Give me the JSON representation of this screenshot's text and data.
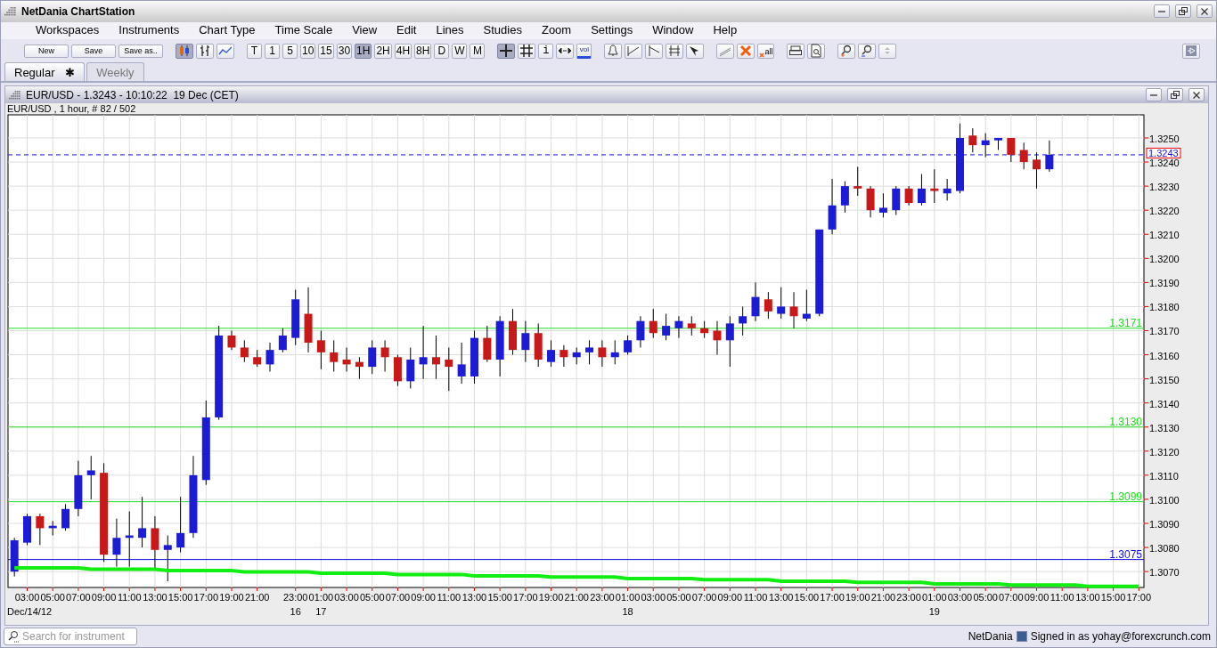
{
  "window": {
    "title": "NetDania ChartStation"
  },
  "menu": [
    "Workspaces",
    "Instruments",
    "Chart Type",
    "Time Scale",
    "View",
    "Edit",
    "Lines",
    "Studies",
    "Zoom",
    "Settings",
    "Window",
    "Help"
  ],
  "toolbar": {
    "buttons": [
      "New",
      "Save",
      "Save as.."
    ],
    "chart_types": [
      {
        "kind": "candlestick",
        "selected": true
      },
      {
        "kind": "bar",
        "selected": false
      },
      {
        "kind": "line",
        "selected": false
      }
    ],
    "time_scales": [
      {
        "label": "T",
        "selected": false
      },
      {
        "label": "1",
        "selected": false
      },
      {
        "label": "5",
        "selected": false
      },
      {
        "label": "10",
        "selected": false
      },
      {
        "label": "15",
        "selected": false
      },
      {
        "label": "30",
        "selected": false
      },
      {
        "label": "1H",
        "selected": true
      },
      {
        "label": "2H",
        "selected": false
      },
      {
        "label": "4H",
        "selected": false
      },
      {
        "label": "8H",
        "selected": false
      },
      {
        "label": "D",
        "selected": false
      },
      {
        "label": "W",
        "selected": false
      },
      {
        "label": "M",
        "selected": false
      }
    ],
    "crosshair_on": true,
    "info_label": "i",
    "volume_label": "vol",
    "delete_all_label": "all"
  },
  "workspace_tabs": [
    {
      "label": "Regular",
      "modified_mark": "✱",
      "selected": true
    },
    {
      "label": "Weekly",
      "selected": false
    }
  ],
  "chart_window": {
    "title": "EUR/USD - 1.3243 - 10:10:22  19 Dec (CET)",
    "subtitle": "EUR/USD , 1 hour, # 82 / 502",
    "chart_data": {
      "type": "candlestick",
      "grid": true,
      "ylim": [
        1.30634,
        1.32596
      ],
      "yticks": [
        {
          "value": 1.307,
          "label": "1.3070"
        },
        {
          "value": 1.308,
          "label": "1.3080"
        },
        {
          "value": 1.309,
          "label": "1.3090"
        },
        {
          "value": 1.31,
          "label": "1.3100"
        },
        {
          "value": 1.311,
          "label": "1.3110"
        },
        {
          "value": 1.312,
          "label": "1.3120"
        },
        {
          "value": 1.313,
          "label": "1.3130"
        },
        {
          "value": 1.314,
          "label": "1.3140"
        },
        {
          "value": 1.315,
          "label": "1.3150"
        },
        {
          "value": 1.316,
          "label": "1.3160"
        },
        {
          "value": 1.317,
          "label": "1.3170"
        },
        {
          "value": 1.318,
          "label": "1.3180"
        },
        {
          "value": 1.319,
          "label": "1.3190"
        },
        {
          "value": 1.32,
          "label": "1.3200"
        },
        {
          "value": 1.321,
          "label": "1.3210"
        },
        {
          "value": 1.322,
          "label": "1.3220"
        },
        {
          "value": 1.323,
          "label": "1.3230"
        },
        {
          "value": 1.324,
          "label": "1.3240"
        },
        {
          "value": 1.325,
          "label": "1.3250"
        }
      ],
      "categories": [
        null,
        "03:00",
        null,
        "05:00",
        null,
        "07:00",
        null,
        "09:00",
        null,
        "11:00",
        null,
        "13:00",
        null,
        "15:00",
        null,
        "17:00",
        null,
        "19:00",
        null,
        "21:00",
        null,
        null,
        "23:00",
        null,
        "01:00",
        null,
        "03:00",
        null,
        "05:00",
        null,
        "07:00",
        null,
        "09:00",
        null,
        "11:00",
        null,
        "13:00",
        null,
        "15:00",
        null,
        "17:00",
        null,
        "19:00",
        null,
        "21:00",
        null,
        "23:00",
        null,
        "01:00",
        null,
        "03:00",
        null,
        "05:00",
        null,
        "07:00",
        null,
        "09:00",
        null,
        "11:00",
        null,
        "13:00",
        null,
        "15:00",
        null,
        "17:00",
        null,
        "19:00",
        null,
        "21:00",
        null,
        "23:00",
        null,
        "01:00",
        null,
        "03:00",
        null,
        "05:00",
        null,
        "07:00",
        null,
        "09:00",
        null,
        "11:00",
        null,
        "13:00",
        null,
        "15:00",
        null,
        "17:00"
      ],
      "ohlc": [
        [
          1.307,
          1.3084,
          1.3068,
          1.3083
        ],
        [
          1.3082,
          1.3094,
          1.3081,
          1.3093
        ],
        [
          1.3093,
          1.3094,
          1.3081,
          1.3088
        ],
        [
          1.3088,
          1.3091,
          1.3085,
          1.3089
        ],
        [
          1.3088,
          1.3098,
          1.3087,
          1.3096
        ],
        [
          1.3096,
          1.3116,
          1.3093,
          1.311
        ],
        [
          1.311,
          1.3118,
          1.31,
          1.3112
        ],
        [
          1.3111,
          1.3115,
          1.3074,
          1.3077
        ],
        [
          1.3077,
          1.3092,
          1.3072,
          1.3084
        ],
        [
          1.3084,
          1.3095,
          1.3072,
          1.3085
        ],
        [
          1.3084,
          1.3101,
          1.308,
          1.3088
        ],
        [
          1.3088,
          1.3093,
          1.3071,
          1.3079
        ],
        [
          1.3079,
          1.3085,
          1.3066,
          1.3081
        ],
        [
          1.308,
          1.3101,
          1.3078,
          1.3086
        ],
        [
          1.3086,
          1.3118,
          1.3084,
          1.311
        ],
        [
          1.3108,
          1.3141,
          1.3106,
          1.3134
        ],
        [
          1.3134,
          1.3172,
          1.3133,
          1.3168
        ],
        [
          1.3168,
          1.317,
          1.3162,
          1.3163
        ],
        [
          1.3163,
          1.3166,
          1.3157,
          1.3159
        ],
        [
          1.3159,
          1.3162,
          1.3155,
          1.3156
        ],
        [
          1.3156,
          1.3165,
          1.3153,
          1.3162
        ],
        [
          1.3162,
          1.3171,
          1.3161,
          1.3168
        ],
        [
          1.3167,
          1.3187,
          1.3164,
          1.3183
        ],
        [
          1.3177,
          1.3188,
          1.3161,
          1.3165
        ],
        [
          1.3166,
          1.317,
          1.3154,
          1.3161
        ],
        [
          1.3161,
          1.3166,
          1.3153,
          1.3157
        ],
        [
          1.3158,
          1.3163,
          1.3153,
          1.3156
        ],
        [
          1.3157,
          1.3159,
          1.315,
          1.3155
        ],
        [
          1.3155,
          1.3166,
          1.3152,
          1.3163
        ],
        [
          1.3163,
          1.3166,
          1.3153,
          1.3159
        ],
        [
          1.3159,
          1.316,
          1.3147,
          1.3149
        ],
        [
          1.3149,
          1.3163,
          1.3146,
          1.3158
        ],
        [
          1.3156,
          1.3172,
          1.315,
          1.3159
        ],
        [
          1.3159,
          1.3168,
          1.315,
          1.3156
        ],
        [
          1.3158,
          1.3163,
          1.3145,
          1.3155
        ],
        [
          1.3151,
          1.3165,
          1.3148,
          1.3156
        ],
        [
          1.3151,
          1.317,
          1.3148,
          1.3167
        ],
        [
          1.3167,
          1.3172,
          1.3157,
          1.3158
        ],
        [
          1.3158,
          1.3176,
          1.3151,
          1.3174
        ],
        [
          1.3174,
          1.3179,
          1.316,
          1.3162
        ],
        [
          1.3162,
          1.3174,
          1.3157,
          1.3169
        ],
        [
          1.3169,
          1.3173,
          1.3155,
          1.3158
        ],
        [
          1.3157,
          1.3166,
          1.3155,
          1.3162
        ],
        [
          1.3162,
          1.3164,
          1.3155,
          1.3159
        ],
        [
          1.3159,
          1.3163,
          1.3156,
          1.3161
        ],
        [
          1.3161,
          1.3166,
          1.3156,
          1.3163
        ],
        [
          1.3163,
          1.3166,
          1.3155,
          1.3159
        ],
        [
          1.3159,
          1.3166,
          1.3156,
          1.3161
        ],
        [
          1.3161,
          1.3168,
          1.316,
          1.3166
        ],
        [
          1.3166,
          1.3176,
          1.3163,
          1.3174
        ],
        [
          1.3174,
          1.3179,
          1.3167,
          1.3169
        ],
        [
          1.3168,
          1.3177,
          1.3166,
          1.3172
        ],
        [
          1.3171,
          1.3176,
          1.3167,
          1.3174
        ],
        [
          1.3173,
          1.3176,
          1.3168,
          1.3171
        ],
        [
          1.3171,
          1.3174,
          1.3167,
          1.3169
        ],
        [
          1.317,
          1.3174,
          1.316,
          1.3166
        ],
        [
          1.3166,
          1.3176,
          1.3155,
          1.3173
        ],
        [
          1.3173,
          1.318,
          1.3168,
          1.3176
        ],
        [
          1.3176,
          1.319,
          1.3174,
          1.3184
        ],
        [
          1.3183,
          1.3186,
          1.3175,
          1.3178
        ],
        [
          1.3177,
          1.3188,
          1.3175,
          1.318
        ],
        [
          1.318,
          1.3186,
          1.3171,
          1.3176
        ],
        [
          1.3175,
          1.3187,
          1.3174,
          1.3177
        ],
        [
          1.3177,
          1.3212,
          1.3176,
          1.3212
        ],
        [
          1.3212,
          1.3233,
          1.321,
          1.3222
        ],
        [
          1.3222,
          1.3232,
          1.3219,
          1.323
        ],
        [
          1.323,
          1.3238,
          1.3226,
          1.3229
        ],
        [
          1.3229,
          1.323,
          1.3217,
          1.322
        ],
        [
          1.3219,
          1.3227,
          1.3217,
          1.3221
        ],
        [
          1.322,
          1.323,
          1.3218,
          1.3229
        ],
        [
          1.3229,
          1.323,
          1.3222,
          1.3223
        ],
        [
          1.3223,
          1.3235,
          1.3222,
          1.3229
        ],
        [
          1.3229,
          1.3237,
          1.3223,
          1.3228
        ],
        [
          1.3227,
          1.3233,
          1.3224,
          1.3229
        ],
        [
          1.3228,
          1.3256,
          1.3227,
          1.325
        ],
        [
          1.3251,
          1.3254,
          1.3244,
          1.3247
        ],
        [
          1.3247,
          1.3252,
          1.3242,
          1.3249
        ],
        [
          1.3249,
          1.325,
          1.3245,
          1.325
        ],
        [
          1.325,
          1.325,
          1.324,
          1.3243
        ],
        [
          1.3245,
          1.3248,
          1.3237,
          1.324
        ],
        [
          1.3241,
          1.3244,
          1.3229,
          1.3237
        ],
        [
          1.3237,
          1.3249,
          1.3236,
          1.3243
        ],
        null,
        null,
        null,
        null,
        null,
        null,
        null
      ],
      "series": [
        {
          "type": "line",
          "color": "#11ee11",
          "values": [
            1.30715,
            1.30715,
            1.30715,
            1.30715,
            1.30715,
            1.30715,
            1.3071,
            1.3071,
            1.3071,
            1.3071,
            1.3071,
            1.3071,
            1.30704,
            1.30704,
            1.30704,
            1.30704,
            1.30704,
            1.30704,
            1.30699,
            1.30699,
            1.30699,
            1.30699,
            1.30699,
            1.30699,
            1.30693,
            1.30693,
            1.30693,
            1.30693,
            1.30693,
            1.30693,
            1.30688,
            1.30688,
            1.30688,
            1.30688,
            1.30688,
            1.30688,
            1.30682,
            1.30682,
            1.30682,
            1.30682,
            1.30682,
            1.30682,
            1.30677,
            1.30677,
            1.30677,
            1.30677,
            1.30677,
            1.30677,
            1.30671,
            1.30671,
            1.30671,
            1.30671,
            1.30671,
            1.30671,
            1.30666,
            1.30666,
            1.30666,
            1.30666,
            1.30666,
            1.30666,
            1.3066,
            1.3066,
            1.3066,
            1.3066,
            1.3066,
            1.3066,
            1.30655,
            1.30655,
            1.30655,
            1.30655,
            1.30655,
            1.30655,
            1.30649,
            1.30649,
            1.30649,
            1.30649,
            1.30649,
            1.30649,
            1.30644,
            1.30644,
            1.30644,
            1.30644,
            1.30644,
            1.30644,
            1.30639,
            1.30639,
            1.30639,
            1.30639,
            1.30639
          ]
        }
      ],
      "ref_lines": [
        {
          "axis": "y",
          "value": 1.3243,
          "label": "1.3243",
          "color": "#1010e0"
        },
        {
          "axis": "y",
          "value": 1.3171,
          "label": "1.3171",
          "color": "#22dd22"
        },
        {
          "axis": "y",
          "value": 1.313,
          "label": "1.3130",
          "color": "#22dd22"
        },
        {
          "axis": "y",
          "value": 1.3099,
          "label": "1.3099",
          "color": "#22dd22"
        },
        {
          "axis": "y",
          "value": 1.3075,
          "label": "1.3075",
          "color": "#1010e0"
        }
      ]
    },
    "date_labels": [
      "Dec/14/12",
      "16",
      "17",
      "18",
      "19"
    ]
  },
  "status_bar": {
    "search": {
      "placeholder": "Search for instrument"
    },
    "brand": "NetDania",
    "signed_in": "Signed in as yohay@forexcrunch.com"
  }
}
